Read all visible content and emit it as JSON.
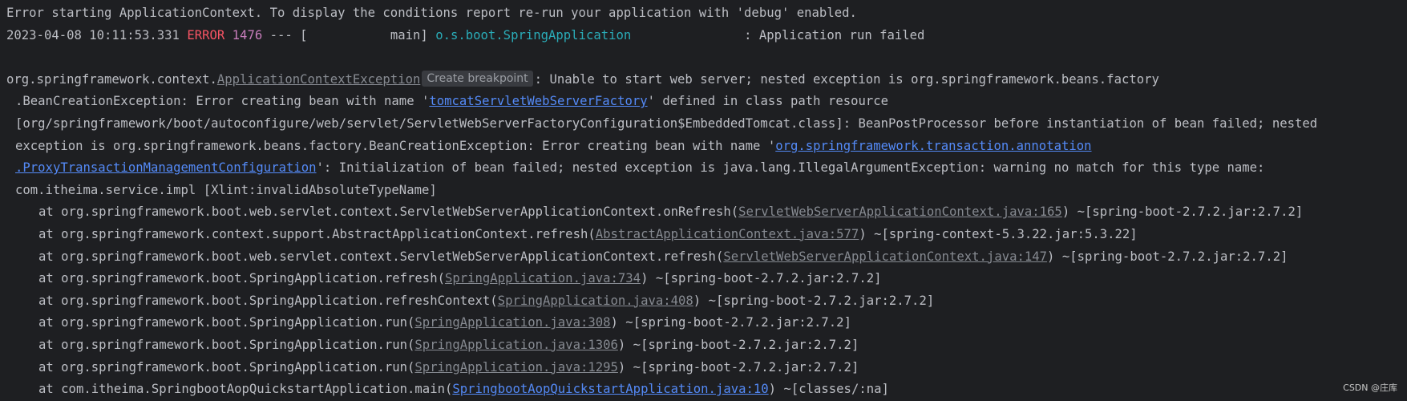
{
  "console": {
    "line1": "Error starting ApplicationContext. To display the conditions report re-run your application with 'debug' enabled.",
    "log": {
      "timestamp": "2023-04-08 10:11:53.331",
      "level": "ERROR",
      "pid": "1476",
      "sep": " --- [",
      "thread": "           main] ",
      "logger": "o.s.boot.SpringApplication",
      "message": "               : Application run failed"
    },
    "exception": {
      "package": "org.springframework.context.",
      "class": "ApplicationContextException",
      "breakpoint_hint": "Create breakpoint",
      "msg1": ": Unable to start web server; nested exception is org.springframework.beans.factory",
      "msg2_pre": ".BeanCreationException: Error creating bean with name '",
      "msg2_link": "tomcatServletWebServerFactory",
      "msg2_post": "' defined in class path resource",
      "msg3": "[org/springframework/boot/autoconfigure/web/servlet/ServletWebServerFactoryConfiguration$EmbeddedTomcat.class]: BeanPostProcessor before instantiation of bean failed; nested",
      "msg4_pre": "exception is org.springframework.beans.factory.BeanCreationException: Error creating bean with name '",
      "msg4_link": "org.springframework.transaction.annotation",
      "msg5_link": ".ProxyTransactionManagementConfiguration",
      "msg5_post": "': Initialization of bean failed; nested exception is java.lang.IllegalArgumentException: warning no match for this type name:",
      "msg6": "com.itheima.service.impl [Xlint:invalidAbsoluteTypeName]"
    },
    "stack": [
      {
        "method": "at org.springframework.boot.web.servlet.context.ServletWebServerApplicationContext.onRefresh(",
        "source": "ServletWebServerApplicationContext.java:165",
        "jar": ") ~[spring-boot-2.7.2.jar:2.7.2]",
        "linked": false
      },
      {
        "method": "at org.springframework.context.support.AbstractApplicationContext.refresh(",
        "source": "AbstractApplicationContext.java:577",
        "jar": ") ~[spring-context-5.3.22.jar:5.3.22]",
        "linked": false
      },
      {
        "method": "at org.springframework.boot.web.servlet.context.ServletWebServerApplicationContext.refresh(",
        "source": "ServletWebServerApplicationContext.java:147",
        "jar": ") ~[spring-boot-2.7.2.jar:2.7.2]",
        "linked": false
      },
      {
        "method": "at org.springframework.boot.SpringApplication.refresh(",
        "source": "SpringApplication.java:734",
        "jar": ") ~[spring-boot-2.7.2.jar:2.7.2]",
        "linked": false
      },
      {
        "method": "at org.springframework.boot.SpringApplication.refreshContext(",
        "source": "SpringApplication.java:408",
        "jar": ") ~[spring-boot-2.7.2.jar:2.7.2]",
        "linked": false
      },
      {
        "method": "at org.springframework.boot.SpringApplication.run(",
        "source": "SpringApplication.java:308",
        "jar": ") ~[spring-boot-2.7.2.jar:2.7.2]",
        "linked": false
      },
      {
        "method": "at org.springframework.boot.SpringApplication.run(",
        "source": "SpringApplication.java:1306",
        "jar": ") ~[spring-boot-2.7.2.jar:2.7.2]",
        "linked": false
      },
      {
        "method": "at org.springframework.boot.SpringApplication.run(",
        "source": "SpringApplication.java:1295",
        "jar": ") ~[spring-boot-2.7.2.jar:2.7.2]",
        "linked": false
      },
      {
        "method": "at com.itheima.SpringbootAopQuickstartApplication.main(",
        "source": "SpringbootAopQuickstartApplication.java:10",
        "jar": ") ~[classes/:na]",
        "linked": true
      }
    ]
  },
  "watermark": "CSDN @庄库",
  "colors": {
    "background": "#1e1f22",
    "text": "#bcbec4",
    "error": "#f75464",
    "pid": "#c77dbb",
    "logger": "#2aacb8",
    "link": "#548af7",
    "muted_link": "#868a91"
  }
}
